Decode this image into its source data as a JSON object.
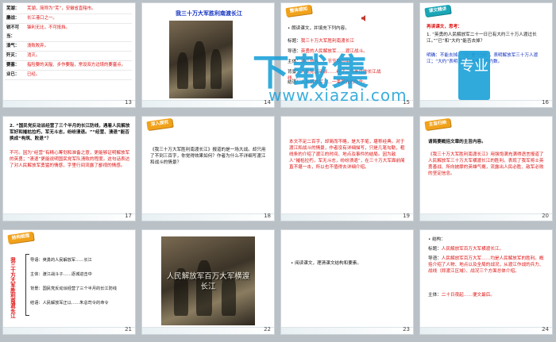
{
  "slides": [
    {
      "number": "13",
      "terms": [
        {
          "term": "芜湖：",
          "def": "芜湖，简称为“芜”，安徽省直辖市。"
        },
        {
          "term": "鏖战：",
          "def": "长江港口之一。"
        },
        {
          "term": "锐不可当：",
          "def": "锋利无比，不可抵挡。"
        },
        {
          "term": "溃气：",
          "def": "溃败败弃。"
        },
        {
          "term": "歼灭：",
          "def": "消灭。"
        },
        {
          "term": "要塞：",
          "def": "指险要的关隘、步作要隘，常设双方边境的要塞点。"
        },
        {
          "term": "业已：",
          "def": "已经。"
        }
      ]
    },
    {
      "number": "14",
      "title": "我三十万大军胜利南渡长江"
    },
    {
      "number": "15",
      "badge": "整体感知",
      "intro": "• 朗读课文，并填充下列内容。",
      "rows": [
        {
          "label": "标题：",
          "value": "我三十万大军胜利南渡长江"
        },
        {
          "label": "导语：",
          "value": "英勇的人民解放军……渡江战斗。"
        },
        {
          "label": "主体：",
          "value": "渡江战斗……节节胜出中。"
        },
        {
          "label": "背景：",
          "value": "人民党反动派……经了三个半月的长江战线……"
        },
        {
          "label": "结语：",
          "value": "人民解放军……一束首先的命令。"
        }
      ]
    },
    {
      "number": "16",
      "badge": "课文精讲",
      "heading": "再读课文，思考：",
      "question": "1. “英勇的人民解放军二十一日已有大约三十万人渡过长江。”“已”和“大约”能否去掉？",
      "answer_label": "明确：",
      "answer": "不能去掉。“已”是“已经”，表明解放军三十万人渡江；“大约”表明三十万人是一个约数。"
    },
    {
      "number": "17",
      "question": "2. “国民党反动派经营了三个半月的长江防线，遇着人民解放军好和摧枯拉朽，军无斗志，纷纷溃退。”“经营、溃退”能否换成“构筑、败退”？",
      "answer": "不可。因为“经营”有精心筹划和准备之意，更能够证明解放军的英勇；“溃退”更能说明国民党军队溃败的程度。这句话表达了对人民解放军勇猛的情感，字里行间流露了鄙视的情感。"
    },
    {
      "number": "18",
      "badge": "深入探究",
      "text": "《我三十万大军胜利南渡长江》报道的是一场大战。却只用了不到三百字，你觉得效果如何？作者为什么不详细写渡江和战斗的情景？"
    },
    {
      "number": "19",
      "text": "本文不足二百字，却简而不略，是大手笔，堪称经典。对于渡江和战斗的情景，作者没有详细描写，只是几笔勾勒，粗线条的介绍了渡江的时间、地点及事件的结局。因为敌人“摧枯拉朽，军无斗志，纷纷溃退”，在三十万大军面前简直不堪一击，所以也不值得去详细介绍。"
    },
    {
      "number": "20",
      "badge": "主旨归纳",
      "heading": "请简要概括文章的主旨内容。",
      "text": "《我三十万大军胜利南渡长江》用强饱满充满得语言报道了人民解放军三十万大军横渡长江的胜利。表现了我军将士英勇善战、所向披靡的英雄气概，流露出人民必胜、敌军必败的坚定信念。"
    },
    {
      "number": "21",
      "badge": "结构梳理",
      "vtitle": "我三十万大军胜利南渡长江",
      "outline": [
        "导语：英勇的人民解放军……长江",
        "主体：渡江战斗子……逐城进击中",
        "背景：国民党反动派经营了三个半月的长江防线",
        "结语：人民解放军正以……朱总司令的命令"
      ]
    },
    {
      "number": "22",
      "caption": "人民解放军百万大军横渡长江"
    },
    {
      "number": "23",
      "intro": "• 阅读课文，理清课文结构和要素。"
    },
    {
      "number": "24",
      "intro": "• 结构：",
      "rows": [
        {
          "label": "标题：",
          "value": "人民解放军百万大军横渡长江。"
        },
        {
          "label": "导语：",
          "value": "人民解放军百万大军……均是人民解放军的胜利。概括介绍了人物、地点以及全局的战况，从渡江作战的兵力、战线（即渡江区域）、战况三个方面总体介绍。"
        },
        {
          "label": "主体：",
          "value": "二十日夜起……便文最后。"
        }
      ]
    }
  ],
  "watermark": {
    "text": "下载集",
    "url": "www.xiazai.com",
    "badge": "专业"
  }
}
